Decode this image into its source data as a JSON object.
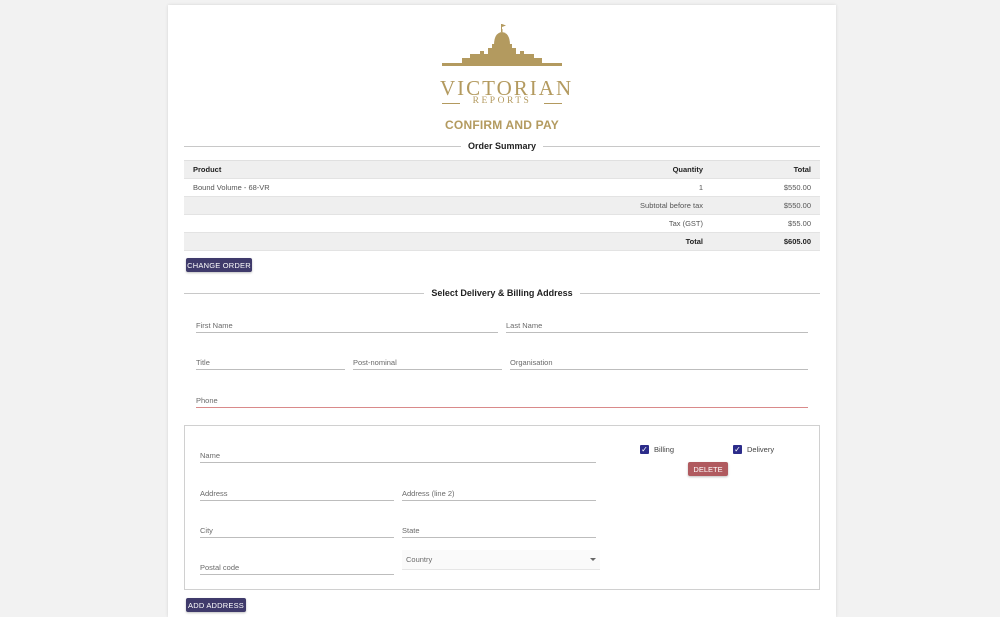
{
  "brand": {
    "name": "VICTORIAN",
    "sub": "REPORTS",
    "color": "#b39a5f"
  },
  "page": {
    "heading": "CONFIRM AND PAY"
  },
  "order_summary": {
    "title": "Order Summary",
    "columns": {
      "product": "Product",
      "quantity": "Quantity",
      "total": "Total"
    },
    "items": [
      {
        "product": "Bound Volume - 68-VR",
        "quantity": "1",
        "total": "$550.00"
      }
    ],
    "subtotal": {
      "label": "Subtotal before tax",
      "value": "$550.00"
    },
    "tax": {
      "label": "Tax (GST)",
      "value": "$55.00"
    },
    "grand_total": {
      "label": "Total",
      "value": "$605.00"
    },
    "change_button": "CHANGE ORDER"
  },
  "address_section": {
    "title": "Select Delivery & Billing Address",
    "fields": {
      "first_name": "First Name",
      "last_name": "Last Name",
      "title": "Title",
      "post_nominal": "Post-nominal",
      "organisation": "Organisation",
      "phone": "Phone"
    },
    "address_card": {
      "name": "Name",
      "address": "Address",
      "address2": "Address (line 2)",
      "city": "City",
      "state": "State",
      "postal_code": "Postal code",
      "country": "Country",
      "billing_label": "Billing",
      "billing_checked": true,
      "delivery_label": "Delivery",
      "delivery_checked": true,
      "delete_button": "DELETE"
    },
    "add_button": "ADD ADDRESS"
  },
  "colors": {
    "primary_button": "#3f3a6b",
    "delete_button": "#b05a5f",
    "checkbox": "#2c2c8a",
    "error_underline": "#d98a8a"
  },
  "icons": {
    "checkbox": "check-icon",
    "select": "chevron-down-icon",
    "logo": "building-icon"
  }
}
